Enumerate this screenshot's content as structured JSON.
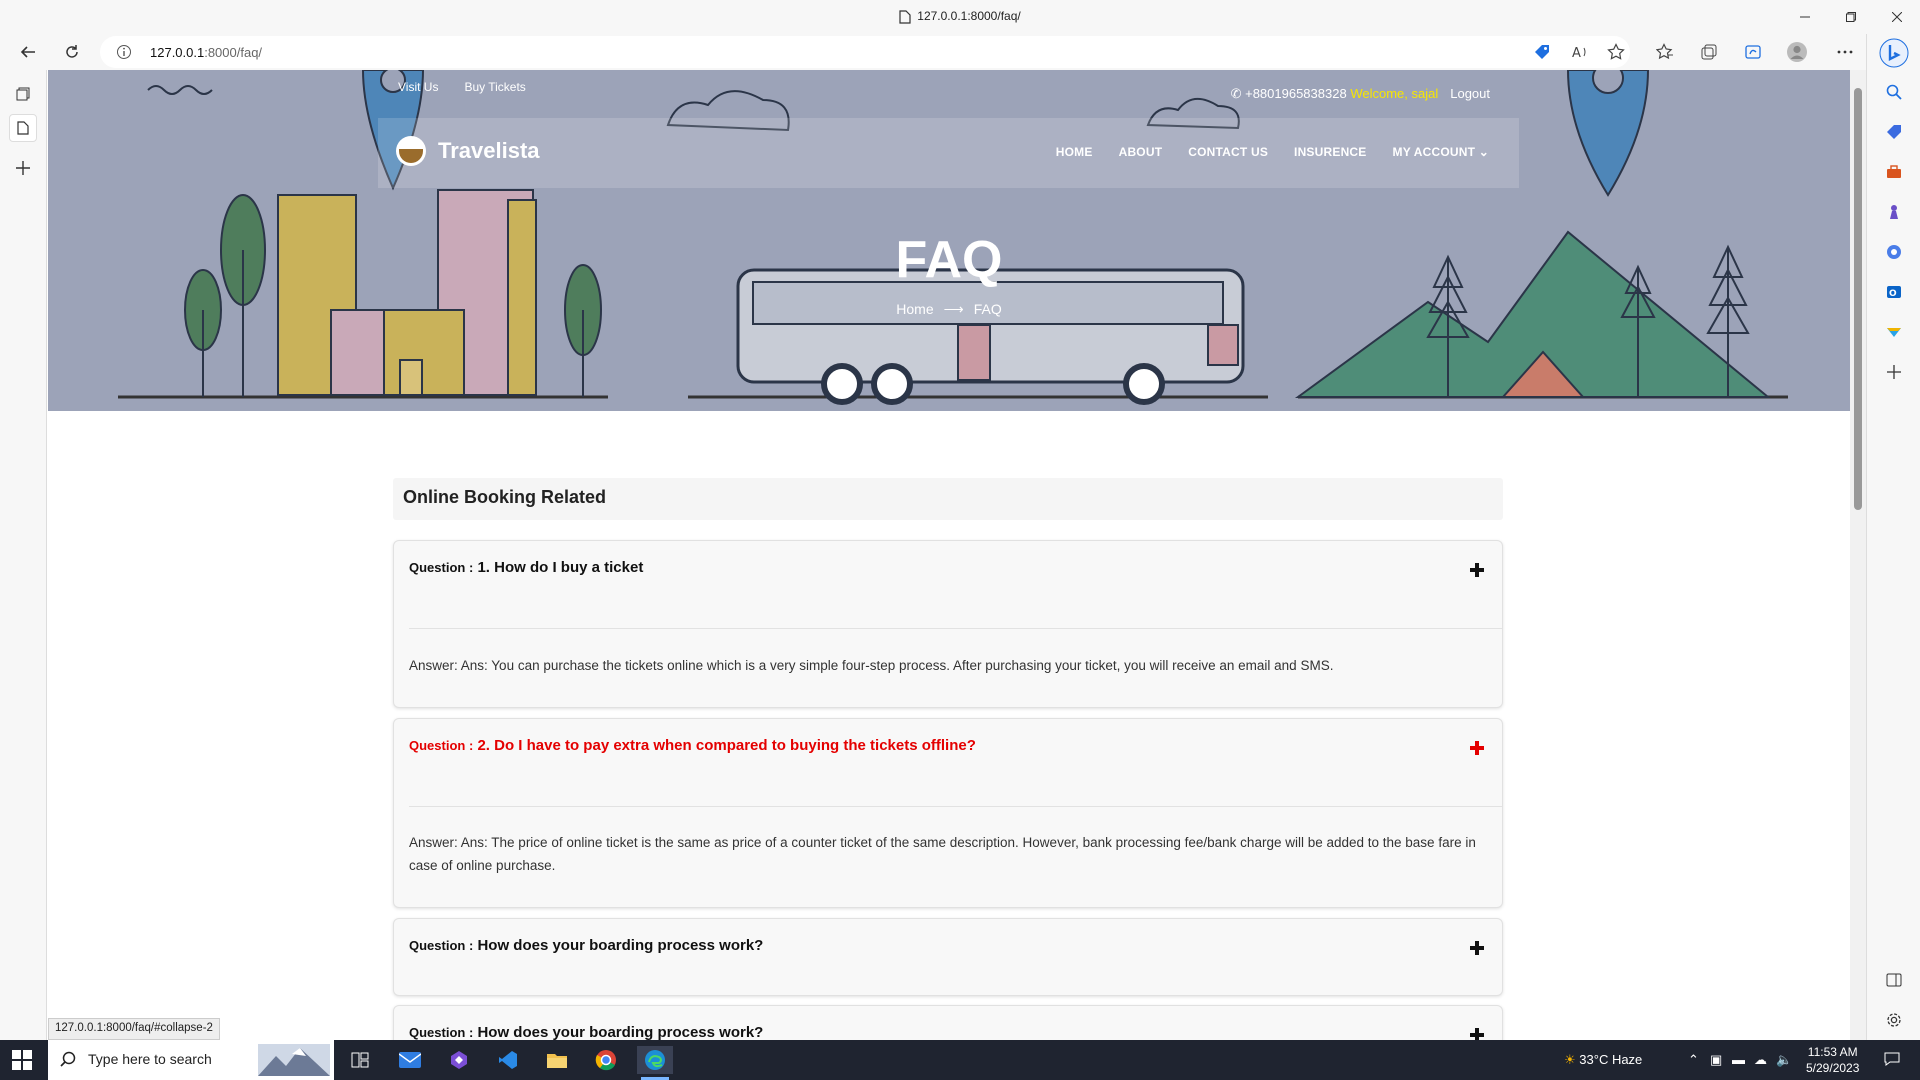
{
  "browser": {
    "tab_title": "127.0.0.1:8000/faq/",
    "url_host": "127.0.0.1",
    "url_path": ":8000/faq/",
    "status_url": "127.0.0.1:8000/faq/#collapse-2"
  },
  "site": {
    "top_links": [
      "Visit Us",
      "Buy Tickets"
    ],
    "phone": "+8801965838328",
    "welcome": "Welcome, sajal",
    "logout": "Logout",
    "brand": "Travelista",
    "menu": [
      "HOME",
      "ABOUT",
      "CONTACT US",
      "INSURENCE",
      "MY ACCOUNT"
    ],
    "hero_title": "FAQ",
    "breadcrumb": [
      "Home",
      "FAQ"
    ]
  },
  "faq": {
    "section": "Online Booking Related",
    "question_label": "Question :",
    "items": [
      {
        "question": "1. How do I buy a ticket",
        "answer": "Answer: Ans: You can purchase the tickets online which is a very simple four-step process. After purchasing your ticket, you will receive an email and SMS."
      },
      {
        "question": "2. Do I have to pay extra when compared to buying the tickets offline?",
        "answer": "Answer: Ans: The price of online ticket is the same as price of a counter ticket of the same description. However, bank processing fee/bank charge will be added to the base fare in case of online purchase."
      },
      {
        "question": "How does your boarding process work?"
      },
      {
        "question": "How does your boarding process work?"
      }
    ]
  },
  "taskbar": {
    "search_placeholder": "Type here to search",
    "weather": "33°C  Haze",
    "time": "11:53 AM",
    "date": "5/29/2023"
  },
  "colors": {
    "accent_red": "#e40000",
    "welcome_yellow": "#f7e600"
  }
}
